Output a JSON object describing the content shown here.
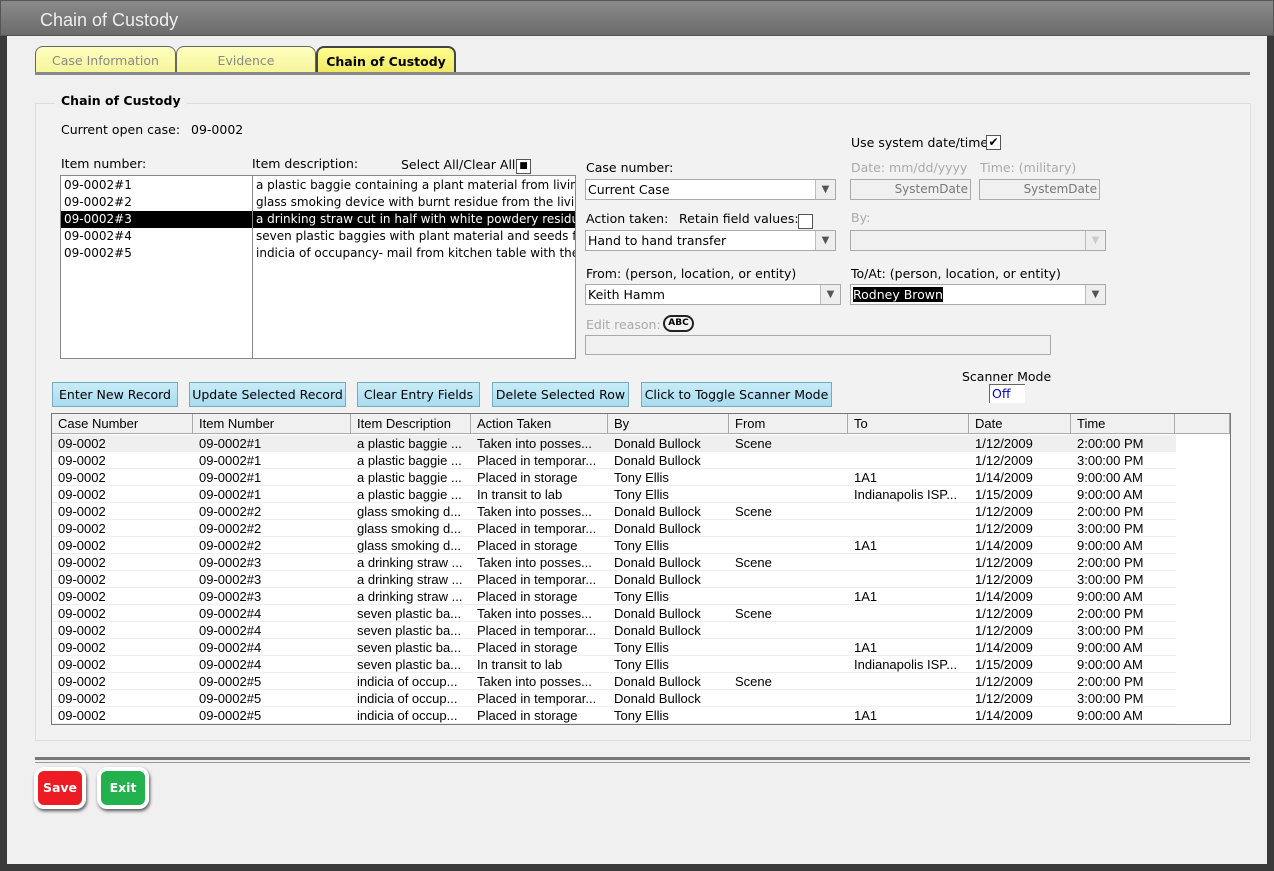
{
  "window": {
    "title": "Chain of Custody"
  },
  "tabs": [
    {
      "label": "Case Information",
      "active": false
    },
    {
      "label": "Evidence",
      "active": false
    },
    {
      "label": "Chain of Custody",
      "active": true
    }
  ],
  "group_title": "Chain of Custody",
  "current_case": {
    "label": "Current open case:",
    "value": "09-0002"
  },
  "items": {
    "number_label": "Item number:",
    "description_label": "Item description:",
    "select_all_label": "Select All/Clear All",
    "list": [
      {
        "number": "09-0002#1",
        "description": "a plastic baggie containing a plant material from living r"
      },
      {
        "number": "09-0002#2",
        "description": "glass smoking device with burnt residue from the living"
      },
      {
        "number": "09-0002#3",
        "description": "a drinking straw cut in half with white powdery residue",
        "selected": true
      },
      {
        "number": "09-0002#4",
        "description": "seven plastic baggies with plant material and seeds from"
      },
      {
        "number": "09-0002#5",
        "description": "indicia of occupancy- mail from kitchen table with the na"
      }
    ]
  },
  "form": {
    "use_system_label": "Use system date/time",
    "use_system_checked": true,
    "case_number_label": "Case number:",
    "case_number_value": "Current Case",
    "date_label": "Date: mm/dd/yyyy",
    "date_value": "SystemDate",
    "time_label": "Time: (military)",
    "time_value": "SystemDate",
    "action_label": "Action taken:",
    "action_value": "Hand to hand transfer",
    "retain_label": "Retain field values:",
    "retain_checked": false,
    "by_label": "By:",
    "by_value": "",
    "from_label": "From: (person, location, or entity)",
    "from_value": "Keith Hamm",
    "to_label": "To/At: (person, location, or entity)",
    "to_value": "Rodney Brown",
    "edit_reason_label": "Edit reason:",
    "spell_check_label": "ABC",
    "edit_reason_value": ""
  },
  "buttons": {
    "enter": "Enter New Record",
    "update": "Update Selected Record",
    "clear": "Clear Entry Fields",
    "delete": "Delete Selected Row",
    "toggle": "Click to Toggle Scanner Mode",
    "save": "Save",
    "exit": "Exit"
  },
  "scanner": {
    "label": "Scanner Mode",
    "value": "Off"
  },
  "colors": {
    "save": "#ed1c24",
    "exit": "#22b14c",
    "button": "#a8dcf0",
    "tab": "#ffff90"
  },
  "table": {
    "columns": [
      "Case Number",
      "Item Number",
      "Item Description",
      "Action Taken",
      "By",
      "From",
      "To",
      "Date",
      "Time"
    ],
    "rows": [
      [
        "09-0002",
        "09-0002#1",
        "a plastic baggie ...",
        "Taken into posses...",
        "Donald Bullock",
        "Scene",
        "",
        "1/12/2009",
        "2:00:00 PM"
      ],
      [
        "09-0002",
        "09-0002#1",
        "a plastic baggie ...",
        "Placed in temporar...",
        "Donald Bullock",
        "",
        "",
        "1/12/2009",
        "3:00:00 PM"
      ],
      [
        "09-0002",
        "09-0002#1",
        "a plastic baggie ...",
        "Placed in storage",
        "Tony Ellis",
        "",
        "1A1",
        "1/14/2009",
        "9:00:00 AM"
      ],
      [
        "09-0002",
        "09-0002#1",
        "a plastic baggie ...",
        "In transit to lab",
        "Tony Ellis",
        "",
        "Indianapolis ISP...",
        "1/15/2009",
        "9:00:00 AM"
      ],
      [
        "09-0002",
        "09-0002#2",
        "glass smoking d...",
        "Taken into posses...",
        "Donald Bullock",
        "Scene",
        "",
        "1/12/2009",
        "2:00:00 PM"
      ],
      [
        "09-0002",
        "09-0002#2",
        "glass smoking d...",
        "Placed in temporar...",
        "Donald Bullock",
        "",
        "",
        "1/12/2009",
        "3:00:00 PM"
      ],
      [
        "09-0002",
        "09-0002#2",
        "glass smoking d...",
        "Placed in storage",
        "Tony Ellis",
        "",
        "1A1",
        "1/14/2009",
        "9:00:00 AM"
      ],
      [
        "09-0002",
        "09-0002#3",
        "a drinking straw ...",
        "Taken into posses...",
        "Donald Bullock",
        "Scene",
        "",
        "1/12/2009",
        "2:00:00 PM"
      ],
      [
        "09-0002",
        "09-0002#3",
        "a drinking straw ...",
        "Placed in temporar...",
        "Donald Bullock",
        "",
        "",
        "1/12/2009",
        "3:00:00 PM"
      ],
      [
        "09-0002",
        "09-0002#3",
        "a drinking straw ...",
        "Placed in storage",
        "Tony Ellis",
        "",
        "1A1",
        "1/14/2009",
        "9:00:00 AM"
      ],
      [
        "09-0002",
        "09-0002#4",
        "seven plastic ba...",
        "Taken into posses...",
        "Donald Bullock",
        "Scene",
        "",
        "1/12/2009",
        "2:00:00 PM"
      ],
      [
        "09-0002",
        "09-0002#4",
        "seven plastic ba...",
        "Placed in temporar...",
        "Donald Bullock",
        "",
        "",
        "1/12/2009",
        "3:00:00 PM"
      ],
      [
        "09-0002",
        "09-0002#4",
        "seven plastic ba...",
        "Placed in storage",
        "Tony Ellis",
        "",
        "1A1",
        "1/14/2009",
        "9:00:00 AM"
      ],
      [
        "09-0002",
        "09-0002#4",
        "seven plastic ba...",
        "In transit to lab",
        "Tony Ellis",
        "",
        "Indianapolis ISP...",
        "1/15/2009",
        "9:00:00 AM"
      ],
      [
        "09-0002",
        "09-0002#5",
        "indicia of occup...",
        "Taken into posses...",
        "Donald Bullock",
        "Scene",
        "",
        "1/12/2009",
        "2:00:00 PM"
      ],
      [
        "09-0002",
        "09-0002#5",
        "indicia of occup...",
        "Placed in temporar...",
        "Donald Bullock",
        "",
        "",
        "1/12/2009",
        "3:00:00 PM"
      ],
      [
        "09-0002",
        "09-0002#5",
        "indicia of occup...",
        "Placed in storage",
        "Tony Ellis",
        "",
        "1A1",
        "1/14/2009",
        "9:00:00 AM"
      ]
    ]
  }
}
